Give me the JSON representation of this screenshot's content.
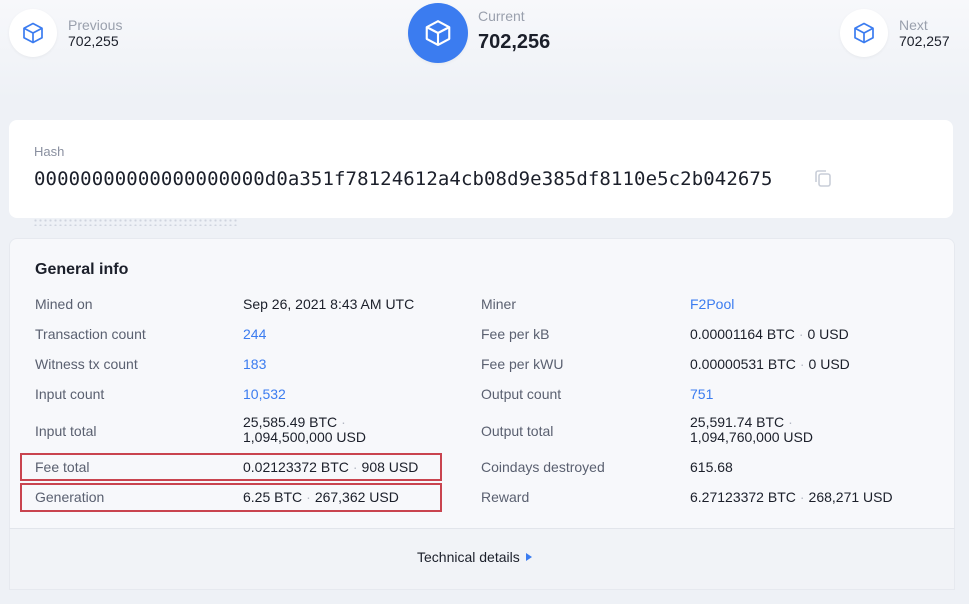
{
  "nav": {
    "previous_label": "Previous",
    "previous_value": "702,255",
    "current_label": "Current",
    "current_value": "702,256",
    "next_label": "Next",
    "next_value": "702,257"
  },
  "hash": {
    "label": "Hash",
    "value": "00000000000000000000d0a351f78124612a4cb08d9e385df8110e5c2b042675"
  },
  "general": {
    "title": "General info",
    "mined_on_label": "Mined on",
    "mined_on_value": "Sep 26, 2021 8:43 AM UTC",
    "tx_count_label": "Transaction count",
    "tx_count_value": "244",
    "witness_label": "Witness tx count",
    "witness_value": "183",
    "input_count_label": "Input count",
    "input_count_value": "10,532",
    "input_total_label": "Input total",
    "input_total_btc": "25,585.49 BTC",
    "input_total_usd": "1,094,500,000 USD",
    "fee_total_label": "Fee total",
    "fee_total_btc": "0.02123372 BTC",
    "fee_total_usd": "908 USD",
    "generation_label": "Generation",
    "generation_btc": "6.25 BTC",
    "generation_usd": "267,362 USD",
    "miner_label": "Miner",
    "miner_value": "F2Pool",
    "fee_kb_label": "Fee per kB",
    "fee_kb_btc": "0.00001164 BTC",
    "fee_kb_usd": "0 USD",
    "fee_kwu_label": "Fee per kWU",
    "fee_kwu_btc": "0.00000531 BTC",
    "fee_kwu_usd": "0 USD",
    "output_count_label": "Output count",
    "output_count_value": "751",
    "output_total_label": "Output total",
    "output_total_btc": "25,591.74 BTC",
    "output_total_usd": "1,094,760,000 USD",
    "coindays_label": "Coindays destroyed",
    "coindays_value": "615.68",
    "reward_label": "Reward",
    "reward_btc": "6.27123372 BTC",
    "reward_usd": "268,271 USD",
    "separator": "·"
  },
  "technical": {
    "label": "Technical details"
  },
  "colors": {
    "accent": "#3b7cf0",
    "highlight": "#c9444f"
  },
  "icons": {
    "block": "cube-icon",
    "copy": "copy-icon",
    "expand": "triangle-right-icon"
  }
}
